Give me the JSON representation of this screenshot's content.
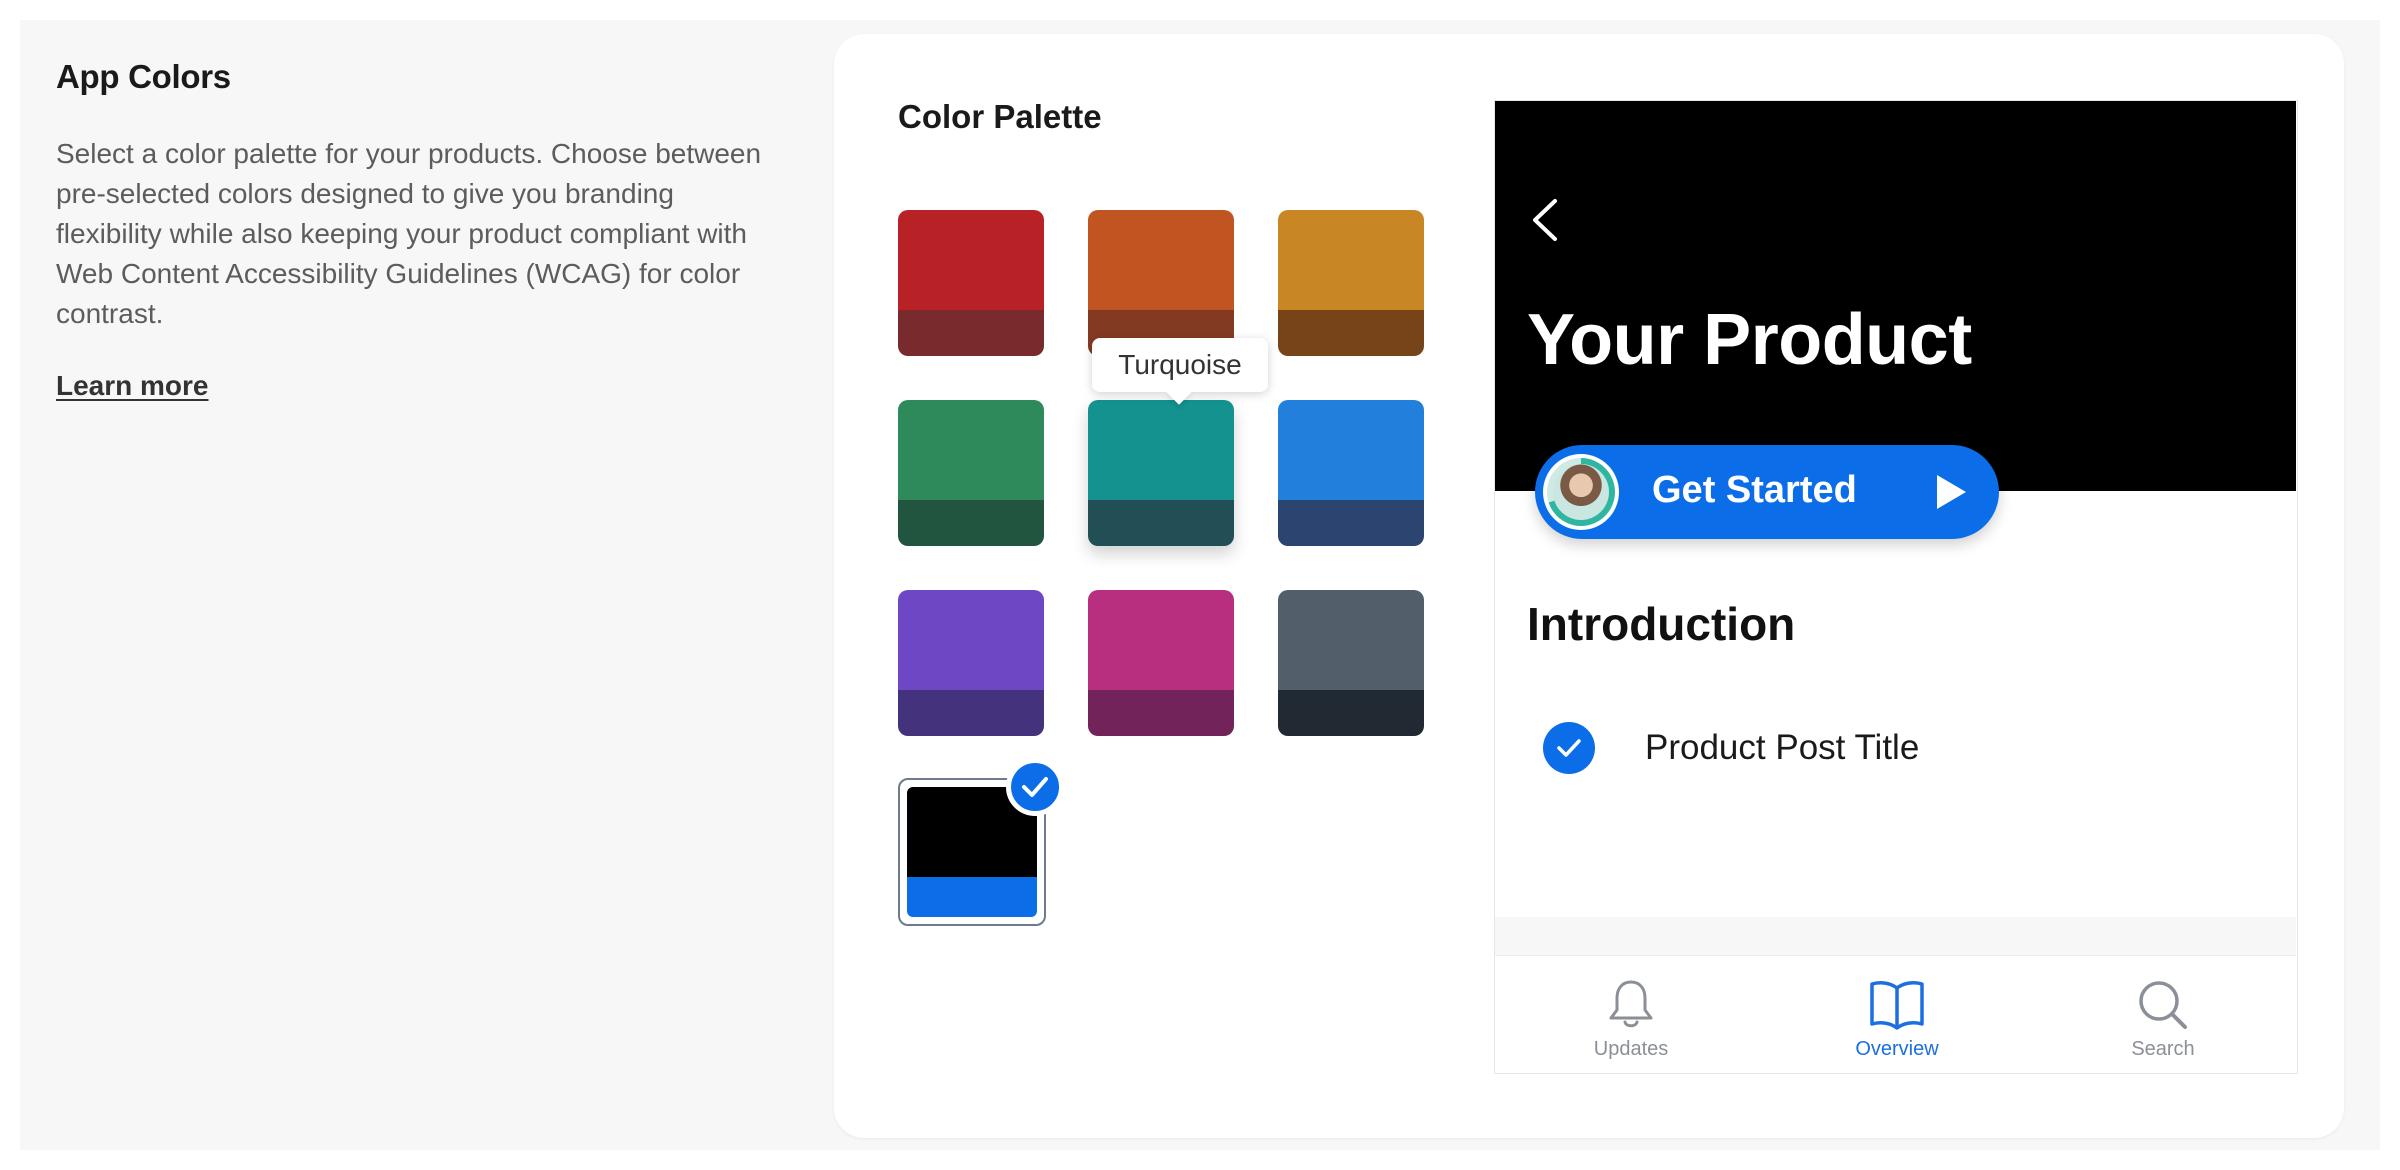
{
  "settings": {
    "title": "App Colors",
    "description": "Select a color palette for your products. Choose between pre-selected colors designed to give you branding flexibility while also keeping your product compliant with Web Content Accessibility Guidelines (WCAG) for color contrast.",
    "learn_more": "Learn more"
  },
  "palette": {
    "title": "Color Palette",
    "tooltip": "Turquoise",
    "swatches": [
      {
        "id": "red",
        "top": "#b82226",
        "bottom": "#782a2c"
      },
      {
        "id": "orange",
        "top": "#c05522",
        "bottom": "#843a22"
      },
      {
        "id": "amber",
        "top": "#c98624",
        "bottom": "#774419"
      },
      {
        "id": "green",
        "top": "#2e8a5a",
        "bottom": "#225540"
      },
      {
        "id": "turquoise",
        "top": "#14928f",
        "bottom": "#224e56"
      },
      {
        "id": "blue",
        "top": "#237fdc",
        "bottom": "#2c4570"
      },
      {
        "id": "purple",
        "top": "#6d47c4",
        "bottom": "#44337c"
      },
      {
        "id": "magenta",
        "top": "#b82f7f",
        "bottom": "#722359"
      },
      {
        "id": "slate",
        "top": "#535e6b",
        "bottom": "#212a33"
      }
    ],
    "selected": {
      "id": "black-blue",
      "top": "#000000",
      "bottom": "#0b6ee8"
    }
  },
  "preview": {
    "hero_title": "Your Product",
    "cta_label": "Get Started",
    "section_title": "Introduction",
    "post_title": "Product Post Title",
    "tabs": [
      {
        "label": "Updates",
        "icon": "bell-icon",
        "active": false
      },
      {
        "label": "Overview",
        "icon": "book-icon",
        "active": true
      },
      {
        "label": "Search",
        "icon": "search-icon",
        "active": false
      }
    ]
  },
  "colors": {
    "accent": "#0b6ee8",
    "hero_background": "#000000"
  }
}
